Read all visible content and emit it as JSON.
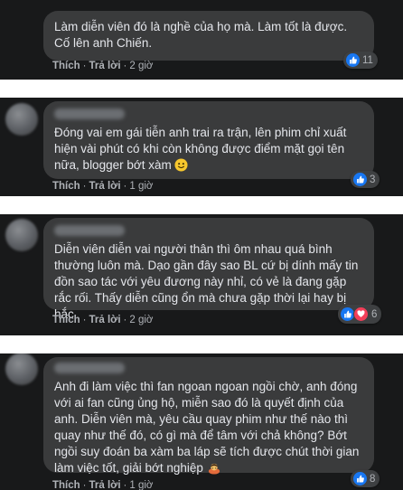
{
  "colors": {
    "panel_bg": "#18191a",
    "bubble_bg": "#3a3b3c",
    "text": "#e4e6eb",
    "meta": "#b0b3b8",
    "like_blue": "#1877f2",
    "love_red": "#f33e58"
  },
  "comments": [
    {
      "text": "Làm diễn viên đó là nghề của họ mà. Làm tốt là được. Cố lên anh Chiến.",
      "like_label": "Thích",
      "reply_label": "Trả lời",
      "time": "2 giờ",
      "reaction_count": "11",
      "reactions": [
        "like-icon"
      ]
    },
    {
      "text": "Đóng vai em gái tiễn anh trai ra trận, lên phim chỉ xuất hiện vài phút có khi còn không được điểm mặt gọi tên nữa, blogger bớt xàm",
      "emoji": "smiling-face-emoji",
      "like_label": "Thích",
      "reply_label": "Trả lời",
      "time": "1 giờ",
      "reaction_count": "3",
      "reactions": [
        "like-icon"
      ]
    },
    {
      "text": "Diễn viên diễn vai người thân thì ôm nhau quá bình thường luôn mà. Dạo gần đây sao BL cứ bị dính mấy tin đồn sao tác với yêu đương này nhỉ, có vẻ là đang gặp rắc rối. Thấy diễn cũng ổn mà chưa gặp thời lại hay bị hắc",
      "like_label": "Thích",
      "reply_label": "Trả lời",
      "time": "2 giờ",
      "reaction_count": "6",
      "reactions": [
        "like-icon",
        "heart-icon"
      ]
    },
    {
      "text": "Anh đi làm việc thì fan ngoan ngoan ngồi chờ, anh đóng với ai fan cũng ủng hộ, miễn sao đó là quyết định của anh. Diễn viên mà, yêu cầu quay phim như thế nào thì quay như thế đó, có gì mà để tâm với chả không? Bớt ngồi suy đoán ba xàm ba láp sẽ tích được chút thời gian làm việc tốt, giải bớt nghiệp",
      "emoji": "person-bowing-emoji",
      "like_label": "Thích",
      "reply_label": "Trả lời",
      "time": "1 giờ",
      "reaction_count": "8",
      "reactions": [
        "like-icon"
      ]
    }
  ]
}
